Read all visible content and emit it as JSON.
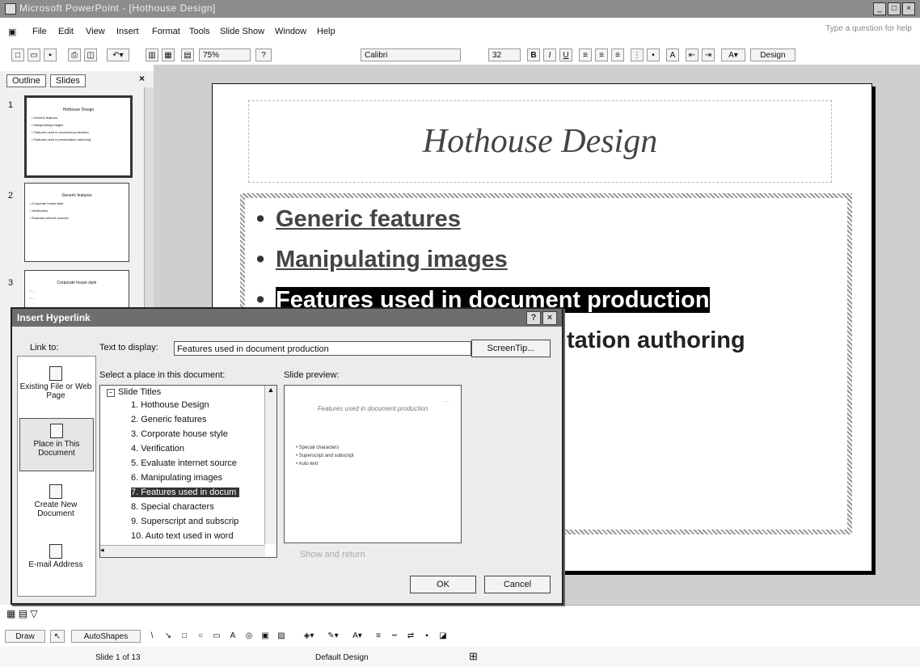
{
  "window": {
    "title": "Microsoft PowerPoint - [Hothouse Design]",
    "buttons": [
      "_",
      "□",
      "×"
    ]
  },
  "menubar": {
    "items": [
      "File",
      "Edit",
      "View",
      "Insert",
      "Format",
      "Tools",
      "Slide Show",
      "Window",
      "Help"
    ],
    "help_placeholder": "Type a question for help"
  },
  "toolbar": {
    "zoom": "75%",
    "font": "Calibri",
    "font_size": "32",
    "bold": "B",
    "italic": "I",
    "underline": "U",
    "design_label": "Design"
  },
  "panel": {
    "tab_outline": "Outline",
    "tab_slides": "Slides",
    "close": "×",
    "thumbs": [
      {
        "num": "1",
        "title": "Hothouse Design",
        "lines": [
          "• Generic features",
          "• Manipulating images",
          "• Features used in document production",
          "• Features used in presentation authoring"
        ]
      },
      {
        "num": "2",
        "title": "Generic features",
        "lines": [
          "• Corporate house style",
          "• Verification",
          "• Evaluate internet sources"
        ]
      },
      {
        "num": "3",
        "title": "Corporate house style",
        "lines": [
          "• ...",
          "• ..."
        ]
      }
    ]
  },
  "slide": {
    "title": "Hothouse Design",
    "bullets": [
      {
        "text": "Generic features",
        "style": "link"
      },
      {
        "text": "Manipulating images",
        "style": "link"
      },
      {
        "text": "Features used in document production",
        "style": "sel"
      },
      {
        "text": "tation authoring",
        "style": "plain"
      }
    ]
  },
  "dialog": {
    "title": "Insert Hyperlink",
    "help": "?",
    "close": "×",
    "link_to_label": "Link to:",
    "text_to_display_label": "Text to display:",
    "text_to_display_value": "Features used in document production",
    "screentip_button": "ScreenTip...",
    "select_place_label": "Select a place in this document:",
    "slide_preview_label": "Slide preview:",
    "show_and_return": "Show and return",
    "ok": "OK",
    "cancel": "Cancel",
    "link_options": [
      {
        "label": "Existing File or Web Page"
      },
      {
        "label": "Place in This Document"
      },
      {
        "label": "Create New Document"
      },
      {
        "label": "E-mail Address"
      }
    ],
    "tree_root": "Slide Titles",
    "tree_items": [
      "1. Hothouse Design",
      "2. Generic features",
      "3. Corporate house style",
      "4. Verification",
      "5. Evaluate internet source",
      "6. Manipulating images",
      "7. Features used in docum",
      "8. Special characters",
      "9. Superscript and subscrip",
      "10. Auto text used in word"
    ],
    "selected_index": 6,
    "preview": {
      "title": "Features used in document production",
      "lines": [
        "• Special characters",
        "• Superscript and subscript",
        "• Auto text"
      ]
    }
  },
  "drawbar": {
    "draw": "Draw",
    "autoshapes": "AutoShapes"
  },
  "status": {
    "slide": "Slide 1 of 13",
    "design": "Default Design"
  }
}
